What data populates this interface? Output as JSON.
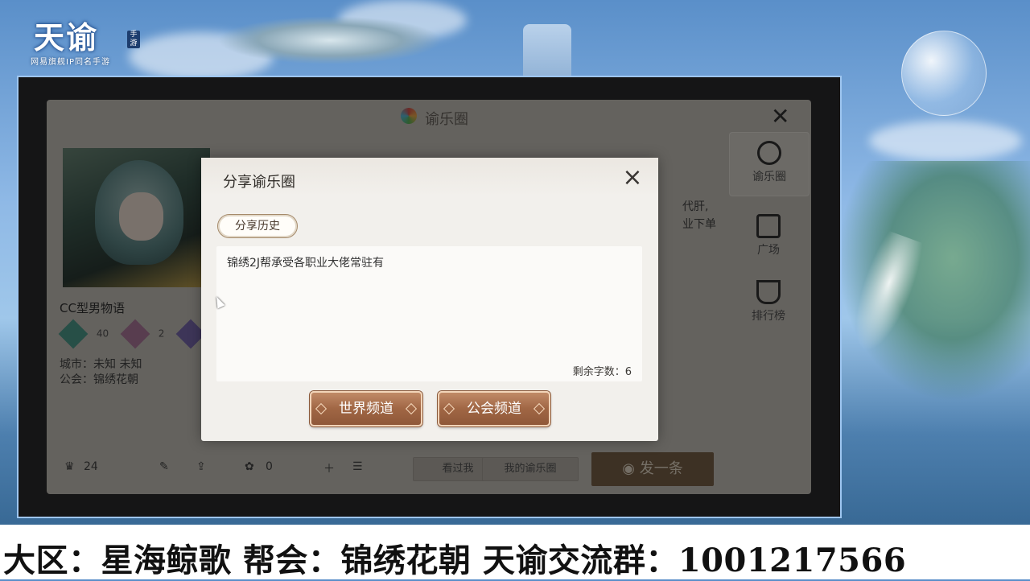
{
  "logo": {
    "main": "天谕",
    "badge": "手游",
    "sub": "网易旗舰IP同名手游"
  },
  "base_panel": {
    "title": "谕乐圈",
    "rail": [
      {
        "label": "谕乐圈",
        "icon": "yule-circle-icon"
      },
      {
        "label": "广场",
        "icon": "fountain-icon"
      },
      {
        "label": "排行榜",
        "icon": "trophy-icon"
      }
    ],
    "user": {
      "name": "CC型男物语",
      "stat_a": "40",
      "stat_b": "2",
      "city_label": "城市：",
      "city_value": "未知 未知",
      "guild_label": "公会：",
      "guild_value": "锦绣花朝"
    },
    "quote_line1": "代肝,",
    "quote_line2": "业下单",
    "likes": "24",
    "flowers": "0",
    "tab_visitors": "看过我",
    "tab_my": "我的谕乐圈",
    "post_button": "发一条"
  },
  "share_dialog": {
    "title": "分享谕乐圈",
    "history_button": "分享历史",
    "message_text": "锦绣2J帮承受各职业大佬常驻有",
    "remaining_label": "剩余字数：",
    "remaining_value": "6",
    "world_channel_button": "世界频道",
    "guild_channel_button": "公会频道"
  },
  "banner": {
    "text": "大区：星海鲸歌 帮会：锦绣花朝 天谕交流群：1001217566"
  },
  "colors": {
    "channel_button": "#a06644",
    "dialog_bg": "#f2f0ec",
    "frame_border": "#9ec6f0"
  }
}
